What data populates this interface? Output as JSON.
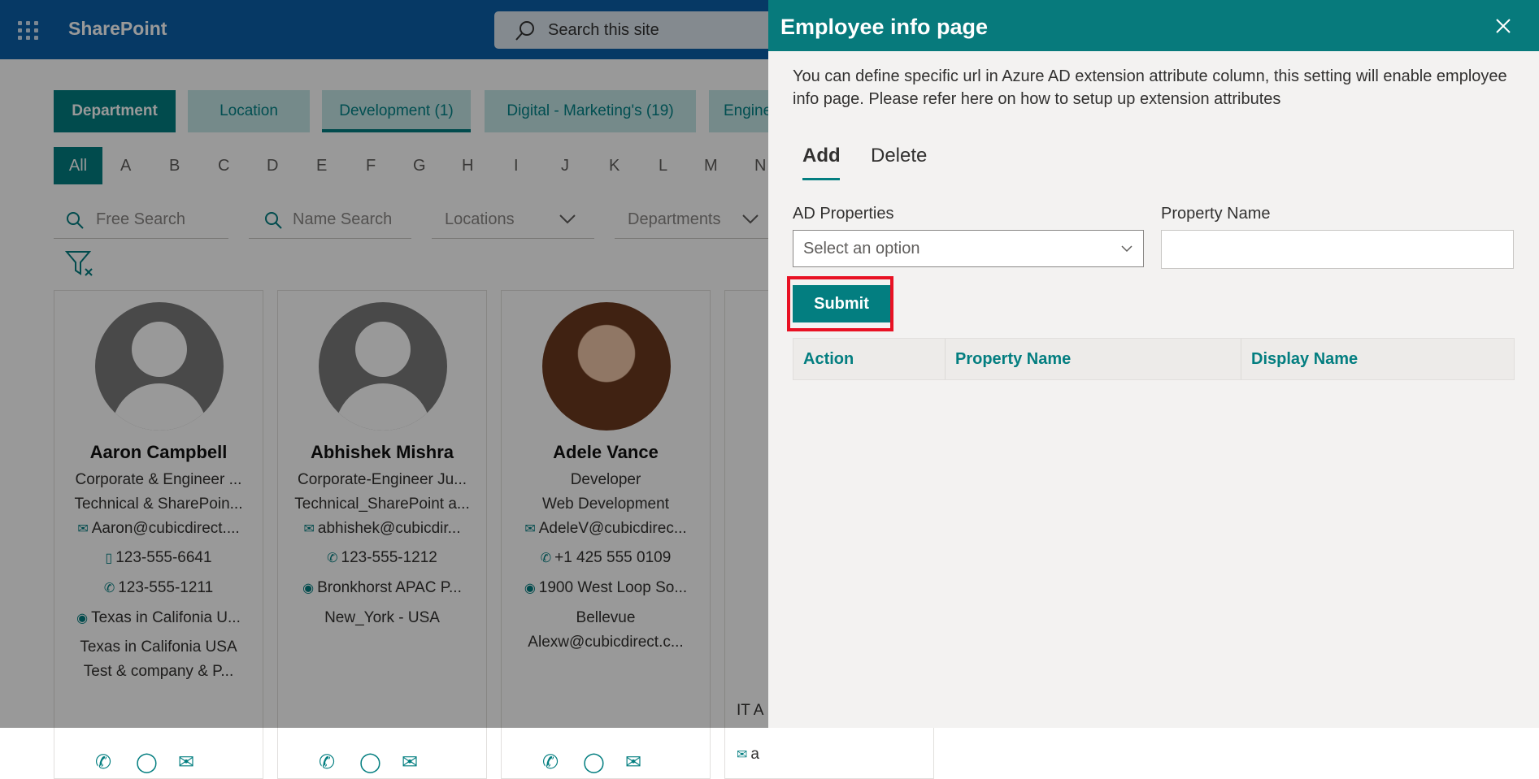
{
  "app": {
    "brand": "SharePoint",
    "search_placeholder": "Search this site"
  },
  "filters": {
    "chips": [
      "Department",
      "Location",
      "Development (1)",
      "Digital - Marketing's (19)",
      "Engine"
    ],
    "alphabet": [
      "All",
      "A",
      "B",
      "C",
      "D",
      "E",
      "F",
      "G",
      "H",
      "I",
      "J",
      "K",
      "L",
      "M",
      "N"
    ],
    "free_search": "Free Search",
    "name_search": "Name Search",
    "locations": "Locations",
    "departments": "Departments"
  },
  "cards": [
    {
      "name": "Aaron Campbell",
      "lines": [
        "Corporate & Engineer ...",
        "Technical & SharePoin...",
        "Aaron@cubicdirect....",
        "123-555-6641",
        "123-555-1211",
        "Texas in Califonia U...",
        "Texas in Califonia USA",
        "Test & company & P..."
      ]
    },
    {
      "name": "Abhishek Mishra",
      "lines": [
        "Corporate-Engineer Ju...",
        "Technical_SharePoint a...",
        "abhishek@cubicdir...",
        "123-555-1212",
        "Bronkhorst APAC P...",
        "New_York - USA"
      ]
    },
    {
      "name": "Adele Vance",
      "lines": [
        "Developer",
        "Web Development",
        "AdeleV@cubicdirec...",
        "+1 425 555 0109",
        "1900 West Loop So...",
        "Bellevue",
        "Alexw@cubicdirect.c..."
      ]
    },
    {
      "name": "",
      "lines": [
        "IT A",
        "a"
      ]
    }
  ],
  "panel": {
    "title": "Employee info page",
    "description": "You can define specific url in Azure AD extension attribute column, this setting will enable employee info page. Please refer here on how to setup up extension attributes",
    "tabs": [
      "Add",
      "Delete"
    ],
    "ad_properties_label": "AD Properties",
    "ad_properties_placeholder": "Select an option",
    "property_name_label": "Property Name",
    "property_name_value": "",
    "submit_label": "Submit",
    "table_headers": [
      "Action",
      "Property Name",
      "Display Name"
    ]
  },
  "colors": {
    "accent": "#037e80",
    "suitebar": "#0a5fa8",
    "highlight": "#e81123"
  }
}
